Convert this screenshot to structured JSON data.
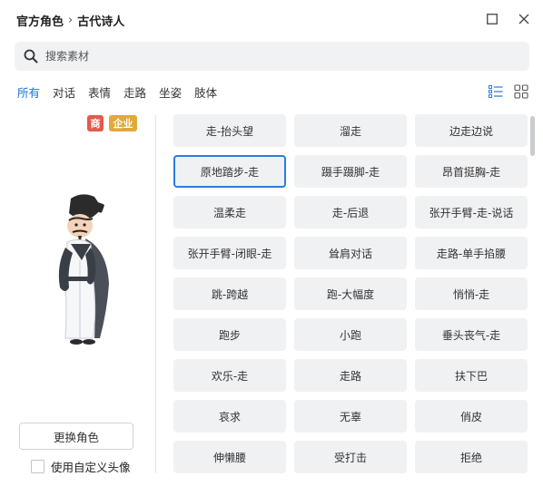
{
  "breadcrumb": {
    "parent": "官方角色",
    "separator": "›",
    "current": "古代诗人"
  },
  "search": {
    "placeholder": "搜索素材",
    "value": ""
  },
  "tabs": [
    {
      "label": "所有",
      "active": true
    },
    {
      "label": "对话",
      "active": false
    },
    {
      "label": "表情",
      "active": false
    },
    {
      "label": "走路",
      "active": false
    },
    {
      "label": "坐姿",
      "active": false
    },
    {
      "label": "肢体",
      "active": false
    }
  ],
  "view_mode": "list",
  "badges": {
    "shang": "商",
    "qiye": "企业"
  },
  "character": {
    "name_icon": "ancient-poet-character"
  },
  "left_panel": {
    "change_role_label": "更换角色",
    "custom_avatar_label": "使用自定义头像",
    "custom_avatar_checked": false
  },
  "actions": [
    "走-抬头望",
    "溜走",
    "边走边说",
    "原地踏步-走",
    "蹑手蹑脚-走",
    "昂首挺胸-走",
    "温柔走",
    "走-后退",
    "张开手臂-走-说话",
    "张开手臂-闭眼-走",
    "耸肩对话",
    "走路-单手掐腰",
    "跳-跨越",
    "跑-大幅度",
    "悄悄-走",
    "跑步",
    "小跑",
    "垂头丧气-走",
    "欢乐-走",
    "走路",
    "扶下巴",
    "哀求",
    "无辜",
    "俏皮",
    "伸懒腰",
    "受打击",
    "拒绝"
  ],
  "selected_action": "原地踏步-走",
  "colors": {
    "accent": "#1a73d9",
    "badge_shang": "#e25b4b",
    "badge_qiye": "#e0a93a",
    "cell_bg": "#f0f1f3"
  }
}
